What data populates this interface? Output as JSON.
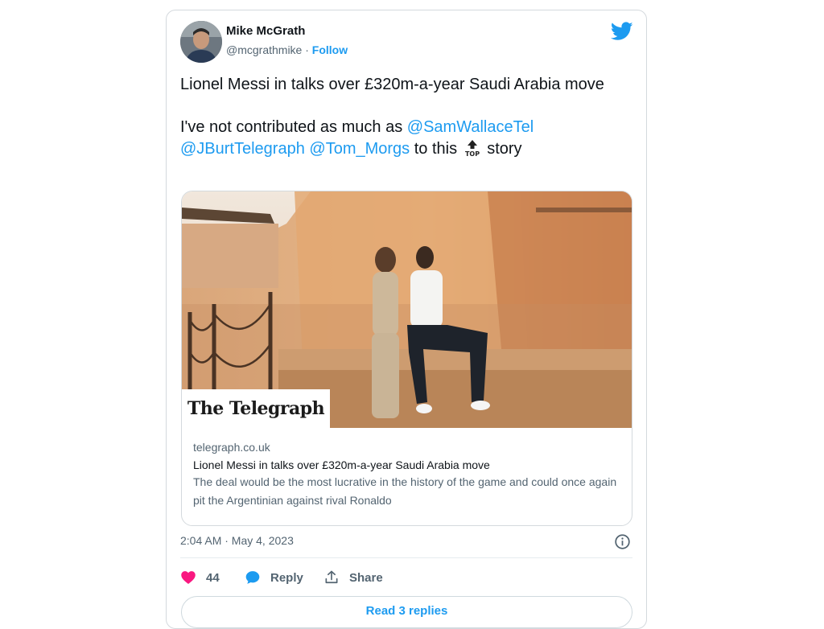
{
  "author": {
    "name": "Mike McGrath",
    "handle": "@mcgrathmike",
    "separator": "·",
    "follow_label": "Follow"
  },
  "tweet": {
    "line1": "Lionel Messi in talks over £320m-a-year Saudi Arabia move",
    "line2_prefix": "I've not contributed as much as",
    "mentions": [
      "@SamWallaceTel",
      "@JBurtTelegraph",
      "@Tom_Morgs"
    ],
    "line2_mid": "to this",
    "emoji_name": "top-arrow-icon",
    "line2_suffix": "story"
  },
  "link_card": {
    "masthead": "The Telegraph",
    "domain": "telegraph.co.uk",
    "title": "Lionel Messi in talks over £320m-a-year Saudi Arabia move",
    "description": "The deal would be the most lucrative in the history of the game and could once again pit the Argentinian against rival Ronaldo"
  },
  "timestamp": "2:04 AM · May 4, 2023",
  "actions": {
    "likes_count": "44",
    "reply_label": "Reply",
    "share_label": "Share"
  },
  "replies_button_label": "Read 3 replies",
  "colors": {
    "accent": "#1d9bf0",
    "like": "#f91880",
    "muted": "#536471"
  }
}
